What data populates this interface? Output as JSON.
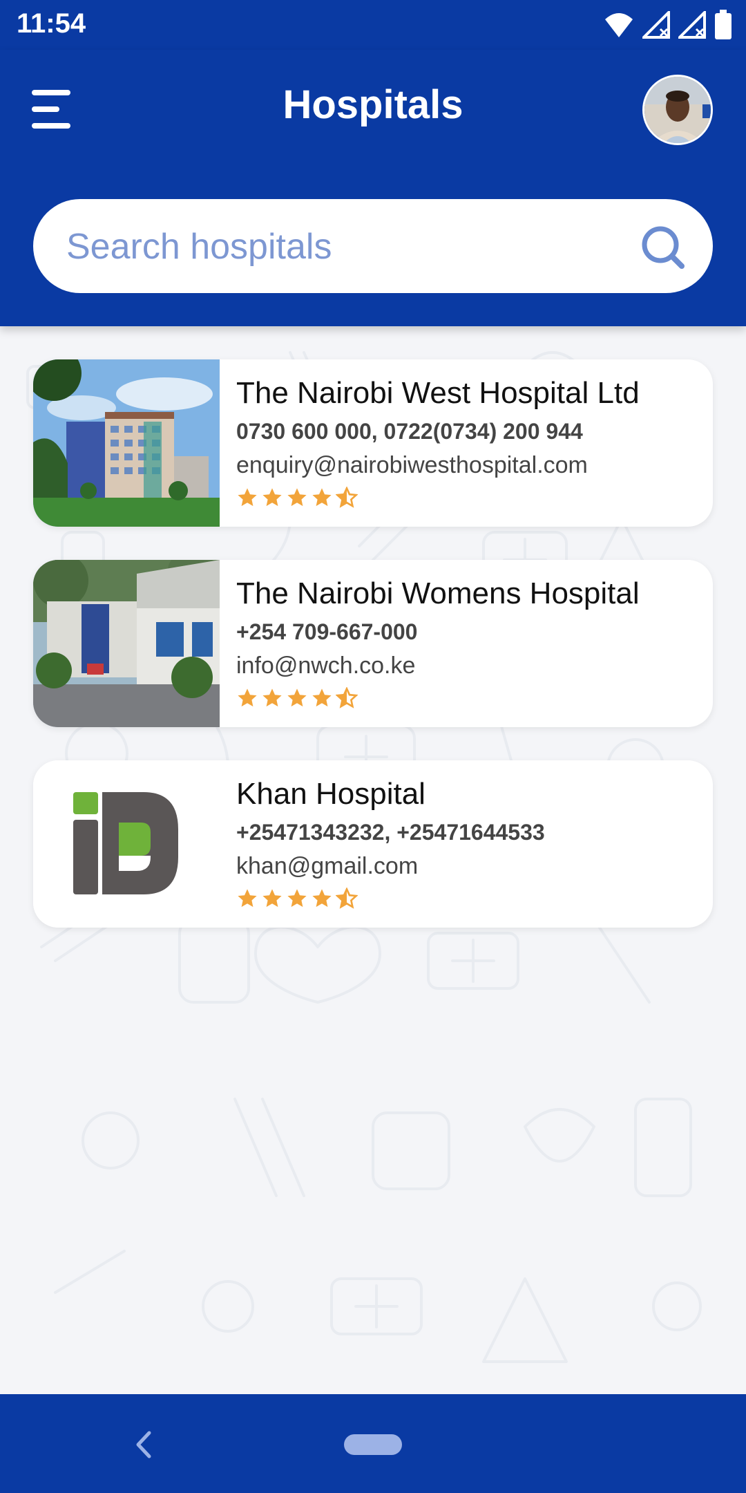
{
  "status_bar": {
    "time": "11:54"
  },
  "header": {
    "title": "Hospitals"
  },
  "search": {
    "placeholder": "Search hospitals",
    "value": ""
  },
  "hospitals": [
    {
      "name": "The Nairobi West Hospital Ltd",
      "phone": "0730 600 000, 0722(0734) 200 944",
      "email": "enquiry@nairobiwesthospital.com",
      "rating": 4.5
    },
    {
      "name": "The Nairobi Womens Hospital",
      "phone": "+254 709-667-000",
      "email": "info@nwch.co.ke",
      "rating": 4.5
    },
    {
      "name": "Khan Hospital",
      "phone": "+25471343232, +25471644533",
      "email": "khan@gmail.com",
      "rating": 4.5
    }
  ],
  "colors": {
    "primary": "#0a3aa3",
    "star": "#f2a43a",
    "search_placeholder": "#7d97d2",
    "nav_pill": "#9cb2e6"
  },
  "icons": {
    "menu": "menu-icon",
    "search": "search-icon",
    "back": "back-icon",
    "star": "star-icon",
    "star_half": "star-half-icon"
  }
}
